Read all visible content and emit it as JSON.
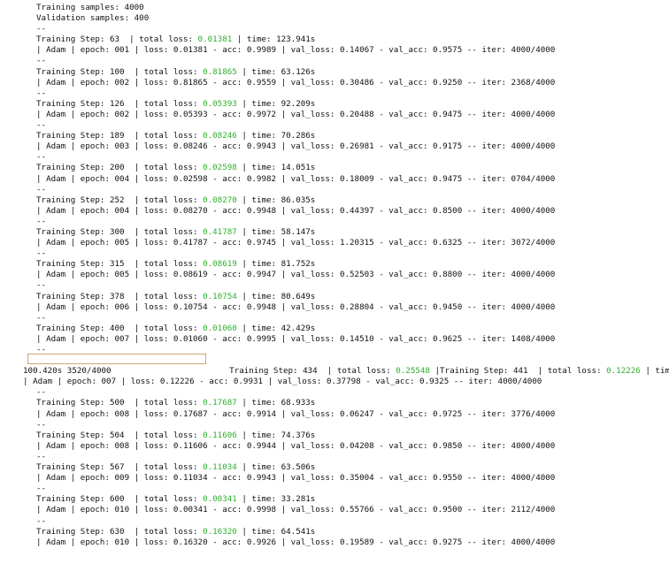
{
  "header": {
    "training_samples": "Training samples: 4000",
    "validation_samples": "Validation samples: 400",
    "separator": "--"
  },
  "entries": [
    {
      "step": "Training Step: 63  | total loss: ",
      "loss": "0.01381",
      "time": " | time: 123.941s",
      "detail": "| Adam | epoch: 001 | loss: 0.01381 - acc: 0.9989 | val_loss: 0.14067 - val_acc: 0.9575 -- iter: 4000/4000"
    },
    {
      "step": "Training Step: 100  | total loss: ",
      "loss": "0.81865",
      "time": " | time: 63.126s",
      "detail": "| Adam | epoch: 002 | loss: 0.81865 - acc: 0.9559 | val_loss: 0.30486 - val_acc: 0.9250 -- iter: 2368/4000"
    },
    {
      "step": "Training Step: 126  | total loss: ",
      "loss": "0.05393",
      "time": " | time: 92.209s",
      "detail": "| Adam | epoch: 002 | loss: 0.05393 - acc: 0.9972 | val_loss: 0.20488 - val_acc: 0.9475 -- iter: 4000/4000"
    },
    {
      "step": "Training Step: 189  | total loss: ",
      "loss": "0.08246",
      "time": " | time: 70.286s",
      "detail": "| Adam | epoch: 003 | loss: 0.08246 - acc: 0.9943 | val_loss: 0.26981 - val_acc: 0.9175 -- iter: 4000/4000"
    },
    {
      "step": "Training Step: 200  | total loss: ",
      "loss": "0.02598",
      "time": " | time: 14.051s",
      "detail": "| Adam | epoch: 004 | loss: 0.02598 - acc: 0.9982 | val_loss: 0.18009 - val_acc: 0.9475 -- iter: 0704/4000"
    },
    {
      "step": "Training Step: 252  | total loss: ",
      "loss": "0.08270",
      "time": " | time: 86.035s",
      "detail": "| Adam | epoch: 004 | loss: 0.08270 - acc: 0.9948 | val_loss: 0.44397 - val_acc: 0.8500 -- iter: 4000/4000"
    },
    {
      "step": "Training Step: 300  | total loss: ",
      "loss": "0.41787",
      "time": " | time: 58.147s",
      "detail": "| Adam | epoch: 005 | loss: 0.41787 - acc: 0.9745 | val_loss: 1.20315 - val_acc: 0.6325 -- iter: 3072/4000"
    },
    {
      "step": "Training Step: 315  | total loss: ",
      "loss": "0.08619",
      "time": " | time: 81.752s",
      "detail": "| Adam | epoch: 005 | loss: 0.08619 - acc: 0.9947 | val_loss: 0.52503 - val_acc: 0.8800 -- iter: 4000/4000"
    },
    {
      "step": "Training Step: 378  | total loss: ",
      "loss": "0.10754",
      "time": " | time: 80.649s",
      "detail": "| Adam | epoch: 006 | loss: 0.10754 - acc: 0.9948 | val_loss: 0.28804 - val_acc: 0.9450 -- iter: 4000/4000"
    },
    {
      "step": "Training Step: 400  | total loss: ",
      "loss": "0.01060",
      "time": " | time: 42.429s",
      "detail": "| Adam | epoch: 007 | loss: 0.01060 - acc: 0.9995 | val_loss: 0.14510 - val_acc: 0.9625 -- iter: 1408/4000"
    }
  ],
  "overlap": {
    "step1": "Training Step: 434  | total loss: ",
    "loss1": "0.25548",
    "step2": " |Training Step: 441  | total loss: ",
    "loss2": "0.12226",
    "tail": " | time:",
    "continuation": "100.420s 3520/4000",
    "detail": "| Adam | epoch: 007 | loss: 0.12226 - acc: 0.9931 | val_loss: 0.37798 - val_acc: 0.9325 -- iter: 4000/4000"
  },
  "entries2": [
    {
      "step": "Training Step: 500  | total loss: ",
      "loss": "0.17687",
      "time": " | time: 68.933s",
      "detail": "| Adam | epoch: 008 | loss: 0.17687 - acc: 0.9914 | val_loss: 0.06247 - val_acc: 0.9725 -- iter: 3776/4000"
    },
    {
      "step": "Training Step: 504  | total loss: ",
      "loss": "0.11606",
      "time": " | time: 74.376s",
      "detail": "| Adam | epoch: 008 | loss: 0.11606 - acc: 0.9944 | val_loss: 0.04208 - val_acc: 0.9850 -- iter: 4000/4000"
    },
    {
      "step": "Training Step: 567  | total loss: ",
      "loss": "0.11034",
      "time": " | time: 63.506s",
      "detail": "| Adam | epoch: 009 | loss: 0.11034 - acc: 0.9943 | val_loss: 0.35004 - val_acc: 0.9550 -- iter: 4000/4000"
    },
    {
      "step": "Training Step: 600  | total loss: ",
      "loss": "0.00341",
      "time": " | time: 33.281s",
      "detail": "| Adam | epoch: 010 | loss: 0.00341 - acc: 0.9998 | val_loss: 0.55766 - val_acc: 0.9500 -- iter: 2112/4000"
    },
    {
      "step": "Training Step: 630  | total loss: ",
      "loss": "0.16320",
      "time": " | time: 64.541s",
      "detail": "| Adam | epoch: 010 | loss: 0.16320 - acc: 0.9926 | val_loss: 0.19589 - val_acc: 0.9275 -- iter: 4000/4000"
    }
  ],
  "colors": {
    "loss_value": "#2fb02f",
    "text": "#111111",
    "obscure_border": "#cfa574"
  }
}
